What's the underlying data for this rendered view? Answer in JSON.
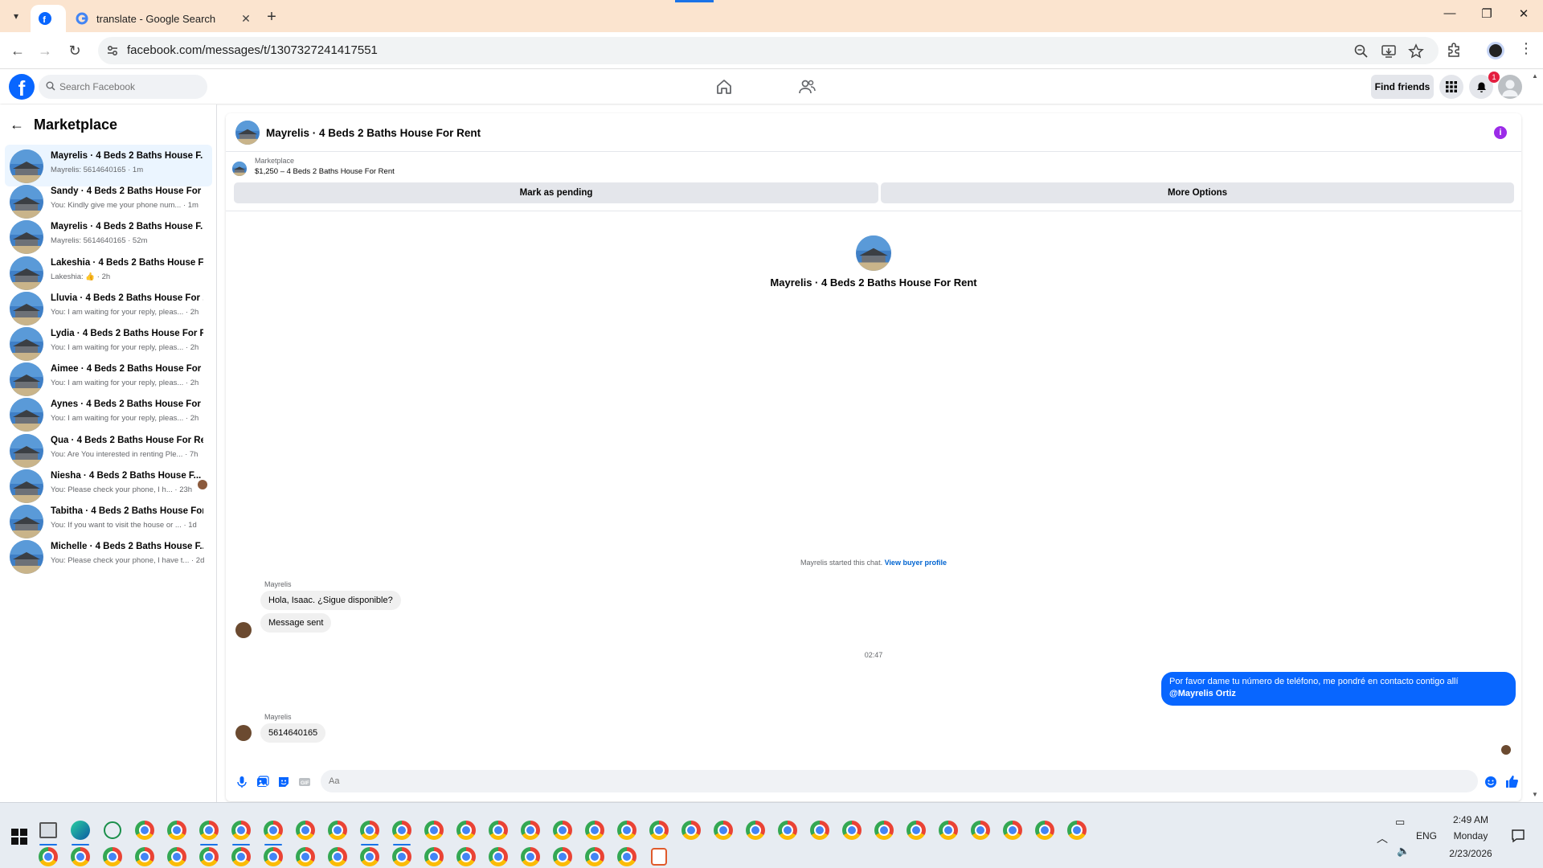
{
  "browser": {
    "tabs": [
      {
        "label": "",
        "icon": "facebook-icon",
        "active": true
      },
      {
        "label": "translate - Google Search",
        "icon": "google-icon",
        "active": false
      }
    ],
    "url": "facebook.com/messages/t/1307327241417551"
  },
  "facebook": {
    "search_placeholder": "Search Facebook",
    "find_friends": "Find friends",
    "notification_count": "1"
  },
  "sidebar": {
    "title": "Marketplace",
    "conversations": [
      {
        "title": "Mayrelis · 4 Beds 2 Baths House F...",
        "preview": "Mayrelis: 5614640165 · 1m"
      },
      {
        "title": "Sandy · 4 Beds 2 Baths House For ...",
        "preview": "You: Kindly give me your phone num... · 1m"
      },
      {
        "title": "Mayrelis · 4 Beds 2 Baths House F...",
        "preview": "Mayrelis: 5614640165 · 52m"
      },
      {
        "title": "Lakeshia · 4 Beds 2 Baths House F...",
        "preview": "Lakeshia: 👍 · 2h"
      },
      {
        "title": "Lluvia · 4 Beds 2 Baths House For ...",
        "preview": "You: I am waiting for your reply, pleas... · 2h"
      },
      {
        "title": "Lydia · 4 Beds 2 Baths House For R...",
        "preview": "You: I am waiting for your reply, pleas... · 2h"
      },
      {
        "title": "Aimee · 4 Beds 2 Baths House For ...",
        "preview": "You: I am waiting for your reply, pleas... · 2h"
      },
      {
        "title": "Aynes · 4 Beds 2 Baths House For ...",
        "preview": "You: I am waiting for your reply, pleas... · 2h"
      },
      {
        "title": "Qua · 4 Beds 2 Baths House For Rent",
        "preview": "You: Are You interested in renting Ple... · 7h"
      },
      {
        "title": "Niesha · 4 Beds 2 Baths House F...",
        "preview": "You: Please check your phone, I h... · 23h"
      },
      {
        "title": "Tabitha · 4 Beds 2 Baths House For...",
        "preview": "You: If you want to visit the house or ... · 1d"
      },
      {
        "title": "Michelle · 4 Beds 2 Baths House F...",
        "preview": "You: Please check your phone, I have t... · 2d"
      }
    ]
  },
  "chat": {
    "title": "Mayrelis · 4 Beds 2 Baths House For Rent",
    "listing_label": "Marketplace",
    "listing_price": "$1,250 – 4 Beds 2 Baths House For Rent",
    "mark_pending": "Mark as pending",
    "more_options": "More Options",
    "hero_name": "Mayrelis · 4 Beds 2 Baths House For Rent",
    "started_text": "Mayrelis started this chat.",
    "view_buyer": "View buyer profile",
    "sender1": "Mayrelis",
    "msg1": "Hola, Isaac. ¿Sigue disponible?",
    "msg2": "Message sent",
    "timestamp": "02:47",
    "out_msg": "Por favor dame tu número de teléfono, me pondré en contacto contigo allí",
    "out_mention": "@Mayrelis Ortiz",
    "sender2": "Mayrelis",
    "msg3": "5614640165",
    "composer_placeholder": "Aa"
  },
  "taskbar": {
    "time": "2:49 AM",
    "day": "Monday",
    "date": "2/23/2026",
    "lang": "ENG"
  },
  "colors": {
    "fb_blue": "#0866ff",
    "tab_strip": "#fbe4cf",
    "active_conv": "#ebf5ff"
  }
}
